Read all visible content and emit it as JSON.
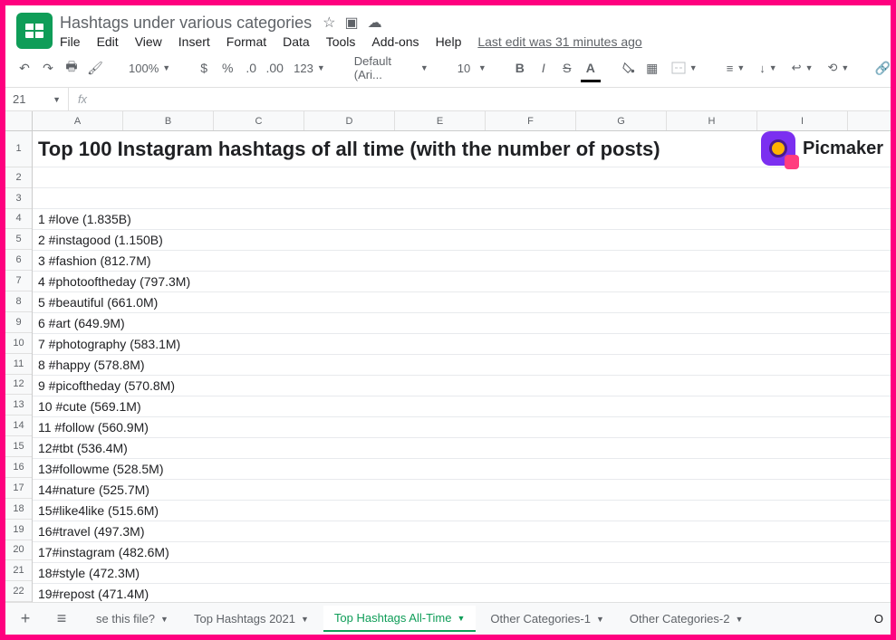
{
  "doc": {
    "title": "Hashtags under various categories",
    "last_edit": "Last edit was 31 minutes ago"
  },
  "menus": [
    "File",
    "Edit",
    "View",
    "Insert",
    "Format",
    "Data",
    "Tools",
    "Add-ons",
    "Help"
  ],
  "toolbar": {
    "zoom": "100%",
    "currency": "$",
    "percent": "%",
    "dec_dec": ".0",
    "inc_dec": ".00",
    "number_format": "123",
    "font": "Default (Ari...",
    "font_size": "10"
  },
  "name_box": "21",
  "columns": [
    "A",
    "B",
    "C",
    "D",
    "E",
    "F",
    "G",
    "H",
    "I"
  ],
  "row_labels": [
    "1",
    "2",
    "3",
    "4",
    "5",
    "6",
    "7",
    "8",
    "9",
    "10",
    "11",
    "12",
    "13",
    "14",
    "15",
    "16",
    "17",
    "18",
    "19",
    "20",
    "21",
    "22"
  ],
  "sheet": {
    "title_cell": "Top 100 Instagram hashtags of all time (with the number of posts)",
    "rows": [
      "",
      "",
      "1 #love (1.835B)",
      "2 #instagood (1.150B)",
      "3 #fashion (812.7M)",
      "4 #photooftheday (797.3M)",
      "5 #beautiful (661.0M)",
      "6 #art (649.9M)",
      "7 #photography (583.1M)",
      "8 #happy (578.8M)",
      "9 #picoftheday (570.8M)",
      "10 #cute (569.1M)",
      "11 #follow (560.9M)",
      "12#tbt (536.4M)",
      "13#followme (528.5M)",
      "14#nature (525.7M)",
      "15#like4like (515.6M)",
      "16#travel (497.3M)",
      "17#instagram (482.6M)",
      "18#style (472.3M)",
      "19#repost (471.4M)"
    ]
  },
  "logo_text": "Picmaker",
  "tabs": {
    "items": [
      "se this file?",
      "Top Hashtags 2021",
      "Top Hashtags All-Time",
      "Other Categories-1",
      "Other Categories-2"
    ],
    "active_index": 2,
    "overflow": "O"
  }
}
